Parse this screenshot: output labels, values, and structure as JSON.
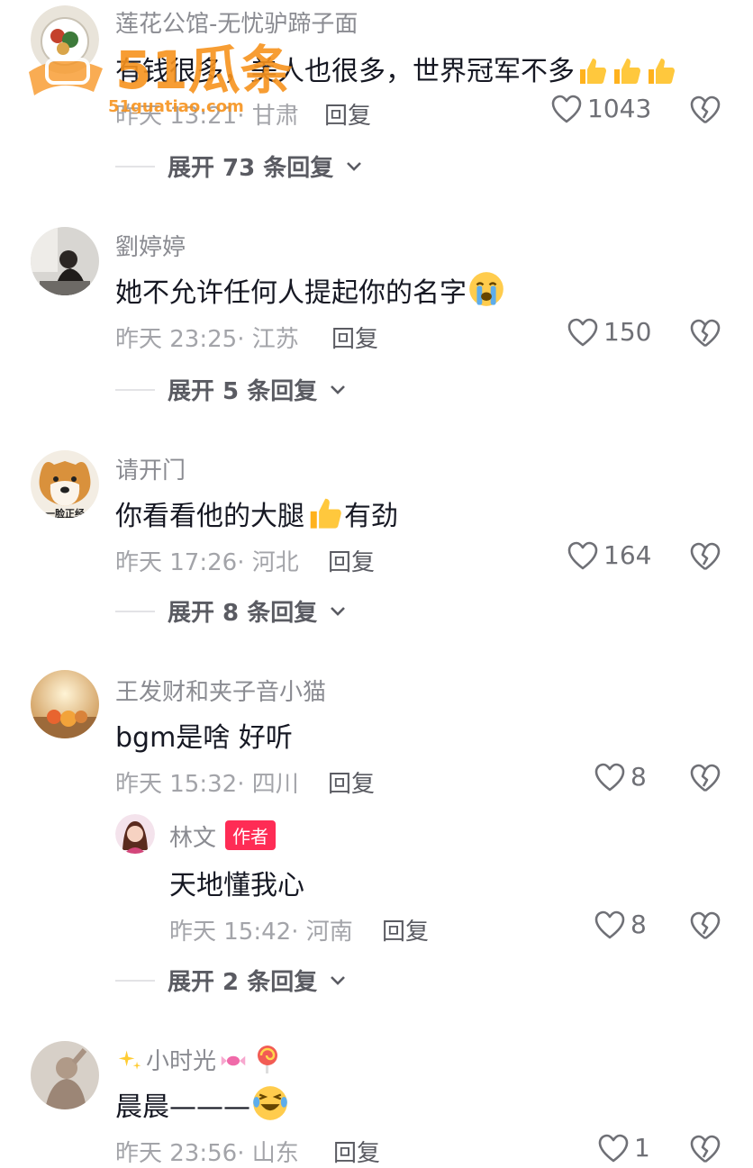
{
  "comments": [
    {
      "username": "莲花公馆-无忧驴蹄子面",
      "content": "有钱很多，美人也很多，世界冠军不多",
      "time": "昨天 13:21",
      "location": "· 甘肃",
      "reply_label": "回复",
      "likes": "1043",
      "expand_label": "展开 73 条回复"
    },
    {
      "username": "劉婷婷",
      "content": "她不允许任何人提起你的名字",
      "time": "昨天 23:25",
      "location": "· 江苏",
      "reply_label": "回复",
      "likes": "150",
      "expand_label": "展开 5 条回复"
    },
    {
      "username": "请开门",
      "content_before": "你看看他的大腿",
      "content_after": "有劲",
      "avatar_caption": "一脸正经",
      "time": "昨天 17:26",
      "location": "· 河北",
      "reply_label": "回复",
      "likes": "164",
      "expand_label": "展开 8 条回复"
    },
    {
      "username": "王发财和夹子音小猫",
      "content": "bgm是啥 好听",
      "time": "昨天 15:32",
      "location": "· 四川",
      "reply_label": "回复",
      "likes": "8",
      "reply": {
        "username": "林文",
        "badge": "作者",
        "content": "天地懂我心",
        "time": "昨天 15:42",
        "location": "· 河南",
        "reply_label": "回复",
        "likes": "8"
      },
      "expand_label": "展开 2 条回复"
    },
    {
      "username": "小时光",
      "content": "晨晨———",
      "time": "昨天 23:56",
      "location": "· 山东",
      "reply_label": "回复",
      "likes": "1"
    }
  ],
  "watermark": {
    "logo": "51瓜条",
    "url": "51guatiao.com"
  },
  "colors": {
    "accent_red": "#fe2c55",
    "watermark_orange": "#f7931e"
  },
  "icons": [
    "heart-icon",
    "broken-heart-icon",
    "chevron-down-icon",
    "thumbs-up-emoji",
    "crying-emoji",
    "laughing-emoji",
    "sparkles-emoji",
    "candy-emoji",
    "lollipop-emoji"
  ]
}
